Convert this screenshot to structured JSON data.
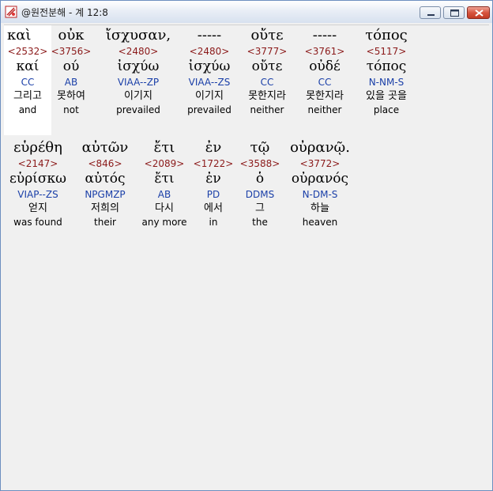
{
  "window": {
    "title": "@원전분해 - 계 12:8",
    "icon": "app-icon",
    "controls": [
      "minimize-icon",
      "maximize-icon",
      "close-icon"
    ]
  },
  "colors": {
    "greek": "#000000",
    "strong_number": "#8b1a1a",
    "morphology": "#1a3fa8",
    "korean": "#000000",
    "english": "#000000",
    "selected_background": "#ffffff"
  },
  "lines": [
    {
      "words": [
        {
          "greek": "καὶ",
          "strong": "<2532>",
          "lemma": "καί",
          "morph": "CC",
          "korean": "그리고",
          "english": "and"
        },
        {
          "greek": "οὐκ",
          "strong": "<3756>",
          "lemma": "ού",
          "morph": "AB",
          "korean": "못하여",
          "english": "not"
        },
        {
          "greek": "ἴσχυσαν,",
          "strong": "<2480>",
          "lemma": "ἰσχύω",
          "morph": "VIAA--ZP",
          "korean": "이기지",
          "english": "prevailed"
        },
        {
          "greek": "-----",
          "strong": "<2480>",
          "lemma": "ἰσχύω",
          "morph": "VIAA--ZS",
          "korean": "이기지",
          "english": "prevailed"
        },
        {
          "greek": "οὔτε",
          "strong": "<3777>",
          "lemma": "οὔτε",
          "morph": "CC",
          "korean": "못한지라",
          "english": "neither"
        },
        {
          "greek": "-----",
          "strong": "<3761>",
          "lemma": "οὐδέ",
          "morph": "CC",
          "korean": "못한지라",
          "english": "neither"
        },
        {
          "greek": "τόπος",
          "strong": "<5117>",
          "lemma": "τόπος",
          "morph": "N-NM-S",
          "korean": "있을 곳을",
          "english": "place"
        }
      ]
    },
    {
      "words": [
        {
          "greek": "εὑρέθη",
          "strong": "<2147>",
          "lemma": "εὑρίσκω",
          "morph": "VIAP--ZS",
          "korean": "얻지",
          "english": "was found"
        },
        {
          "greek": "αὐτῶν",
          "strong": "<846>",
          "lemma": "αὐτός",
          "morph": "NPGMZP",
          "korean": "저희의",
          "english": "their"
        },
        {
          "greek": "ἔτι",
          "strong": "<2089>",
          "lemma": "ἔτι",
          "morph": "AB",
          "korean": "다시",
          "english": "any more"
        },
        {
          "greek": "ἐν",
          "strong": "<1722>",
          "lemma": "ἐν",
          "morph": "PD",
          "korean": "에서",
          "english": "in"
        },
        {
          "greek": "τῷ",
          "strong": "<3588>",
          "lemma": "ὁ",
          "morph": "DDMS",
          "korean": "그",
          "english": "the"
        },
        {
          "greek": "οὐρανῷ.",
          "strong": "<3772>",
          "lemma": "οὐρανός",
          "morph": "N-DM-S",
          "korean": "하늘",
          "english": "heaven"
        }
      ]
    }
  ]
}
